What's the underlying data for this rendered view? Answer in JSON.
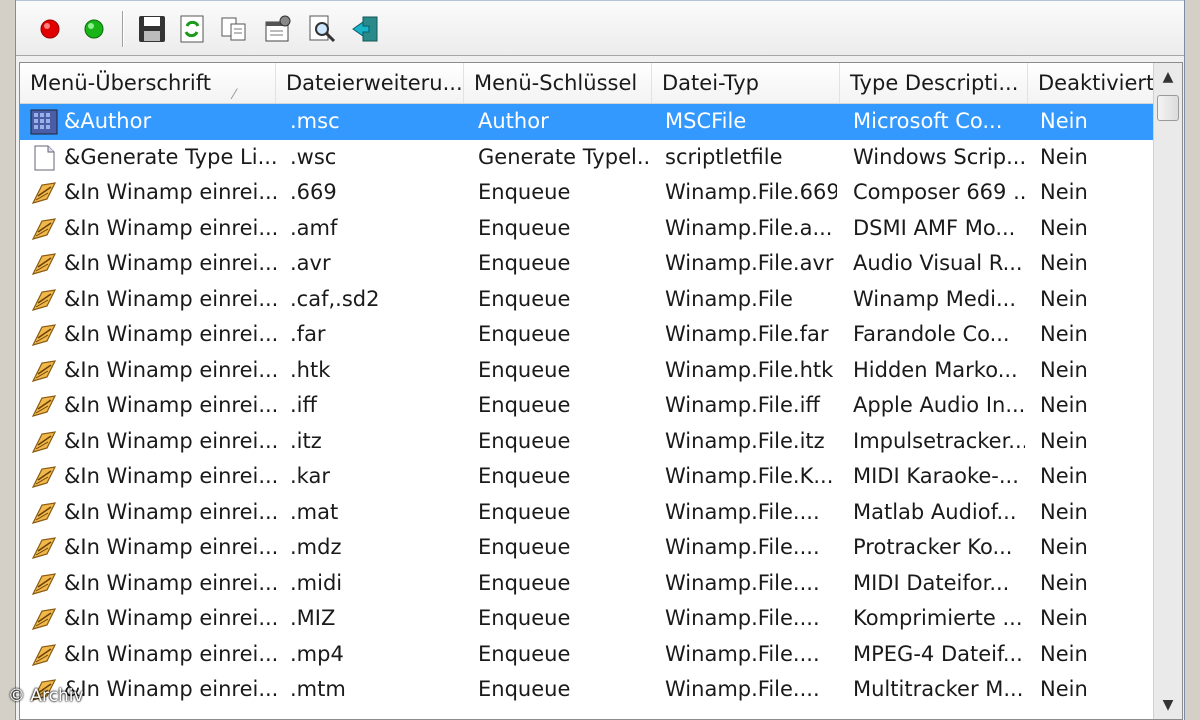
{
  "toolbar": {
    "buttons": [
      {
        "name": "record-red-button",
        "icon": "red-dot-icon",
        "color": "#e00000"
      },
      {
        "name": "record-green-button",
        "icon": "green-dot-icon",
        "color": "#18b418"
      },
      {
        "name": "save-button",
        "icon": "floppy-disk-icon"
      },
      {
        "name": "refresh-button",
        "icon": "refresh-icon"
      },
      {
        "name": "copy-button",
        "icon": "copy-icon"
      },
      {
        "name": "properties-button",
        "icon": "properties-icon"
      },
      {
        "name": "search-button",
        "icon": "search-icon"
      },
      {
        "name": "exit-button",
        "icon": "exit-door-icon"
      }
    ]
  },
  "columns": [
    "Menü-Überschrift",
    "Dateierweiteru...",
    "Menü-Schlüssel",
    "Datei-Typ",
    "Type Descripti...",
    "Deaktiviert"
  ],
  "rows": [
    {
      "icon": "msc-icon",
      "selected": true,
      "c": [
        "&Author",
        ".msc",
        "Author",
        "MSCFile",
        "Microsoft Co...",
        "Nein"
      ]
    },
    {
      "icon": "document-icon",
      "c": [
        "&Generate Type Li...",
        ".wsc",
        "Generate Typel...",
        "scriptletfile",
        "Windows Scrip...",
        "Nein"
      ]
    },
    {
      "icon": "winamp-icon",
      "c": [
        "&In Winamp einrei...",
        ".669",
        "Enqueue",
        "Winamp.File.669",
        "Composer 669 ...",
        "Nein"
      ]
    },
    {
      "icon": "winamp-icon",
      "c": [
        "&In Winamp einrei...",
        ".amf",
        "Enqueue",
        "Winamp.File.a...",
        "DSMI AMF Mo...",
        "Nein"
      ]
    },
    {
      "icon": "winamp-icon",
      "c": [
        "&In Winamp einrei...",
        ".avr",
        "Enqueue",
        "Winamp.File.avr",
        "Audio Visual R...",
        "Nein"
      ]
    },
    {
      "icon": "winamp-icon",
      "c": [
        "&In Winamp einrei...",
        ".caf,.sd2",
        "Enqueue",
        "Winamp.File",
        "Winamp Medi...",
        "Nein"
      ]
    },
    {
      "icon": "winamp-icon",
      "c": [
        "&In Winamp einrei...",
        ".far",
        "Enqueue",
        "Winamp.File.far",
        "Farandole Co...",
        "Nein"
      ]
    },
    {
      "icon": "winamp-icon",
      "c": [
        "&In Winamp einrei...",
        ".htk",
        "Enqueue",
        "Winamp.File.htk",
        "Hidden Marko...",
        "Nein"
      ]
    },
    {
      "icon": "winamp-icon",
      "c": [
        "&In Winamp einrei...",
        ".iff",
        "Enqueue",
        "Winamp.File.iff",
        "Apple Audio In...",
        "Nein"
      ]
    },
    {
      "icon": "winamp-icon",
      "c": [
        "&In Winamp einrei...",
        ".itz",
        "Enqueue",
        "Winamp.File.itz",
        "Impulsetracker...",
        "Nein"
      ]
    },
    {
      "icon": "winamp-icon",
      "c": [
        "&In Winamp einrei...",
        ".kar",
        "Enqueue",
        "Winamp.File.K...",
        "MIDI Karaoke-...",
        "Nein"
      ]
    },
    {
      "icon": "winamp-icon",
      "c": [
        "&In Winamp einrei...",
        ".mat",
        "Enqueue",
        "Winamp.File....",
        "Matlab Audiof...",
        "Nein"
      ]
    },
    {
      "icon": "winamp-icon",
      "c": [
        "&In Winamp einrei...",
        ".mdz",
        "Enqueue",
        "Winamp.File....",
        "Protracker Ko...",
        "Nein"
      ]
    },
    {
      "icon": "winamp-icon",
      "c": [
        "&In Winamp einrei...",
        ".midi",
        "Enqueue",
        "Winamp.File....",
        "MIDI Dateifor...",
        "Nein"
      ]
    },
    {
      "icon": "winamp-icon",
      "c": [
        "&In Winamp einrei...",
        ".MIZ",
        "Enqueue",
        "Winamp.File....",
        "Komprimierte ...",
        "Nein"
      ]
    },
    {
      "icon": "winamp-icon",
      "c": [
        "&In Winamp einrei...",
        ".mp4",
        "Enqueue",
        "Winamp.File....",
        "MPEG-4 Dateif...",
        "Nein"
      ]
    },
    {
      "icon": "winamp-icon",
      "c": [
        "&In Winamp einrei...",
        ".mtm",
        "Enqueue",
        "Winamp.File....",
        "Multitracker M...",
        "Nein"
      ]
    }
  ],
  "colors": {
    "selection": "#3399ff"
  },
  "watermark": "© Archiv"
}
